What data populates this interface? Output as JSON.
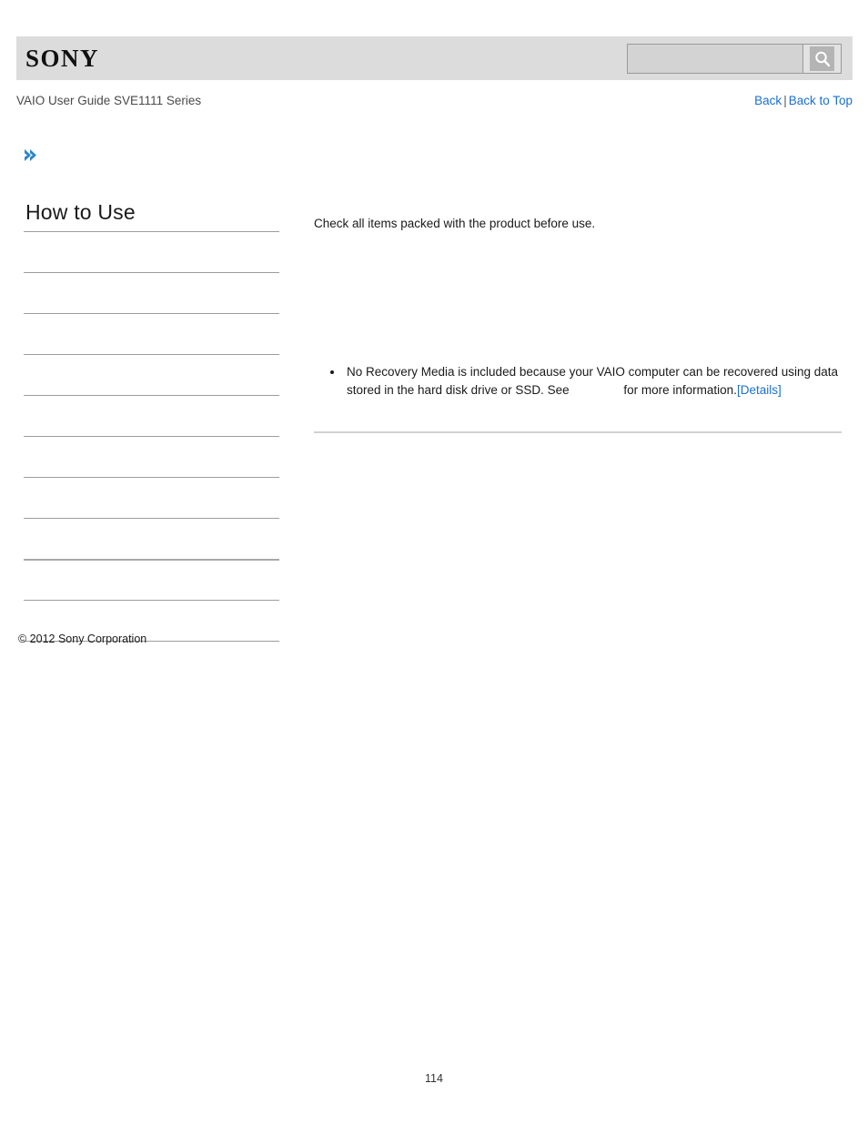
{
  "header": {
    "logo_text": "SONY",
    "search": {
      "value": "",
      "placeholder": "",
      "icon": "search-icon",
      "button_label": ""
    }
  },
  "guide_bar": {
    "title": "VAIO User Guide SVE1111 Series",
    "back_label": "Back",
    "separator": "|",
    "back_to_top_label": "Back to Top"
  },
  "breadcrumb": {
    "icon": "double-chevron-right-icon",
    "text": ""
  },
  "sidebar": {
    "heading": "How to Use",
    "items": [
      {
        "label": ""
      },
      {
        "label": ""
      },
      {
        "label": ""
      },
      {
        "label": ""
      },
      {
        "label": ""
      },
      {
        "label": ""
      },
      {
        "label": ""
      },
      {
        "label": ""
      },
      {
        "label": ""
      },
      {
        "label": ""
      }
    ]
  },
  "footer": {
    "copyright": "© 2012 Sony Corporation"
  },
  "main": {
    "intro": "Check all items packed with the product before use.",
    "notes": [
      {
        "text": "No Recovery Media is included because your VAIO computer can be recovered using data stored in the hard disk drive or SSD. See",
        "continuation": "for more information.",
        "link_label": "[Details]"
      }
    ]
  },
  "page": {
    "number": "114"
  },
  "colors": {
    "header_bg": "#dcdcdc",
    "link": "#1a6fd4",
    "chevron": "#2b86c5",
    "rule": "#9d9d9d"
  }
}
